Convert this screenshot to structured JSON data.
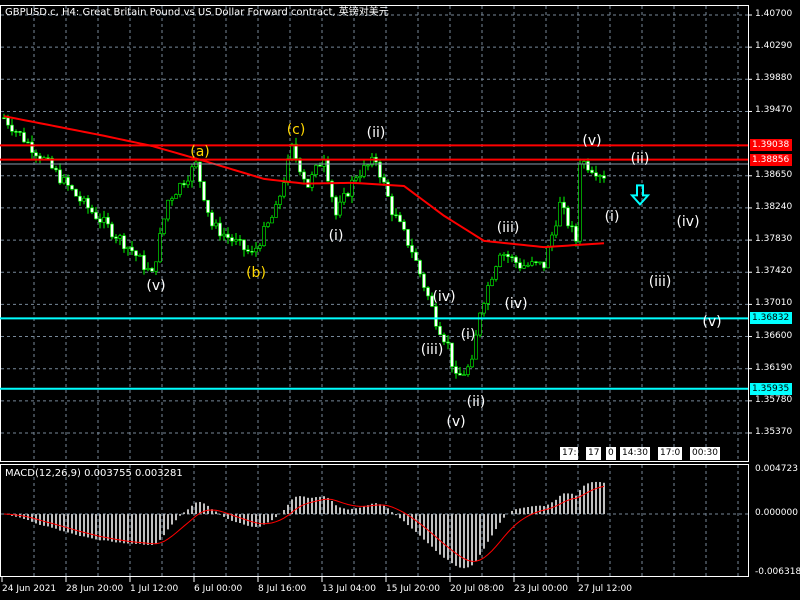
{
  "title": "GBPUSD.c, H4:  Great Britain Pound vs US Dollar Forward contract, 英镑对美元",
  "macd_title": "MACD(12,26,9) 0.003755 0.003281",
  "colors": {
    "background": "#000000",
    "grid": "#778899",
    "candle_wick": "#00ff00",
    "bear_body": "#ffffff",
    "ma": "#ff0000",
    "resistance": "#ff0000",
    "support": "#00ffff",
    "histogram": "#c0c0c0",
    "signal": "#ff0000",
    "wave_yellow": "#ffd700",
    "wave_white": "#ffffff"
  },
  "price_axis": [
    "1.40700",
    "1.40290",
    "1.39880",
    "1.39470",
    "1.38650",
    "1.38240",
    "1.37830",
    "1.37420",
    "1.37010",
    "1.36600",
    "1.36190",
    "1.35780",
    "1.35370"
  ],
  "macd_axis": [
    "0.004723",
    "0.000000",
    "-0.006318"
  ],
  "time_axis": [
    "24 Jun 2021",
    "28 Jun 20:00",
    "1 Jul 12:00",
    "6 Jul 00:00",
    "8 Jul 16:00",
    "13 Jul 04:00",
    "15 Jul 20:00",
    "20 Jul 08:00",
    "23 Jul 00:00",
    "27 Jul 12:00"
  ],
  "hlines": [
    {
      "price": "1.39038",
      "color": "#ff0000",
      "label_bg": "#ff0000",
      "label_color": "#ffffff"
    },
    {
      "price": "1.38856",
      "color": "#ff0000",
      "label_bg": "#ff0000",
      "label_color": "#ffffff"
    },
    {
      "price": "1.36832",
      "color": "#00ffff",
      "label_bg": "#00ffff",
      "label_color": "#000000"
    },
    {
      "price": "1.35935",
      "color": "#00ffff",
      "label_bg": "#00ffff",
      "label_color": "#000000"
    }
  ],
  "bid_line_price": 1.388,
  "time_markers": [
    "17:",
    "17",
    "0",
    "14:30",
    "17:0",
    "00:30"
  ],
  "chart_data": {
    "type": "candlestick",
    "ylim": [
      1.3537,
      1.407
    ],
    "close_path": [
      [
        0,
        1.3939
      ],
      [
        9,
        1.3891
      ],
      [
        19,
        1.3834
      ],
      [
        32,
        1.377
      ],
      [
        37,
        1.3738
      ],
      [
        41,
        1.3834
      ],
      [
        48,
        1.3879
      ],
      [
        52,
        1.3802
      ],
      [
        62,
        1.3764
      ],
      [
        68,
        1.3821
      ],
      [
        72,
        1.39
      ],
      [
        76,
        1.3853
      ],
      [
        80,
        1.3891
      ],
      [
        83,
        1.3815
      ],
      [
        88,
        1.3866
      ],
      [
        93,
        1.3885
      ],
      [
        97,
        1.3821
      ],
      [
        102,
        1.377
      ],
      [
        108,
        1.3681
      ],
      [
        111,
        1.3649
      ],
      [
        113,
        1.3605
      ],
      [
        117,
        1.3624
      ],
      [
        119,
        1.3694
      ],
      [
        124,
        1.377
      ],
      [
        129,
        1.3751
      ],
      [
        135,
        1.3751
      ],
      [
        139,
        1.3828
      ],
      [
        143,
        1.3783
      ],
      [
        144,
        1.3885
      ],
      [
        150,
        1.3866
      ]
    ],
    "moving_average_path": [
      [
        0,
        1.3941
      ],
      [
        25,
        1.3916
      ],
      [
        37,
        1.3903
      ],
      [
        50,
        1.3884
      ],
      [
        65,
        1.3861
      ],
      [
        75,
        1.3855
      ],
      [
        87,
        1.3856
      ],
      [
        100,
        1.3852
      ],
      [
        110,
        1.3814
      ],
      [
        120,
        1.3782
      ],
      [
        135,
        1.3774
      ],
      [
        150,
        1.3779
      ]
    ],
    "macd": {
      "fast": 12,
      "slow": 26,
      "signal": 9,
      "ylim": [
        -0.006318,
        0.004723
      ]
    },
    "wave_labels": [
      {
        "text": "(a)",
        "color": "yellow",
        "bar": 49,
        "price": 1.3895
      },
      {
        "text": "(b)",
        "color": "yellow",
        "bar": 63,
        "price": 1.3741
      },
      {
        "text": "(c)",
        "color": "yellow",
        "bar": 73,
        "price": 1.3923
      },
      {
        "text": "(v)",
        "color": "white",
        "bar": 38,
        "price": 1.3725
      },
      {
        "text": "(ii)",
        "color": "white",
        "bar": 93,
        "price": 1.3919
      },
      {
        "text": "(i)",
        "color": "white",
        "bar": 83,
        "price": 1.3788
      },
      {
        "text": "(iv)",
        "color": "white",
        "bar": 110,
        "price": 1.3711
      },
      {
        "text": "(iii)",
        "color": "white",
        "bar": 107,
        "price": 1.3643
      },
      {
        "text": "(i)",
        "color": "white",
        "bar": 116,
        "price": 1.3662
      },
      {
        "text": "(ii)",
        "color": "white",
        "bar": 118,
        "price": 1.3577
      },
      {
        "text": "(v)",
        "color": "white",
        "bar": 113,
        "price": 1.3551
      },
      {
        "text": "(iii)",
        "color": "white",
        "bar": 126,
        "price": 1.3799
      },
      {
        "text": "(iv)",
        "color": "white",
        "bar": 128,
        "price": 1.3702
      },
      {
        "text": "(v)",
        "color": "white",
        "bar": 147,
        "price": 1.3909
      },
      {
        "text": "(ii)",
        "color": "white",
        "bar": 159,
        "price": 1.3886
      },
      {
        "text": "(i)",
        "color": "white",
        "bar": 152,
        "price": 1.3813
      },
      {
        "text": "(iv)",
        "color": "white",
        "bar": 171,
        "price": 1.3806
      },
      {
        "text": "(iii)",
        "color": "white",
        "bar": 164,
        "price": 1.3729
      },
      {
        "text": "(v)",
        "color": "white",
        "bar": 177,
        "price": 1.3679
      }
    ],
    "arrow": {
      "direction": "down",
      "color": "#00ffff",
      "bar": 159,
      "price": 1.384
    }
  }
}
